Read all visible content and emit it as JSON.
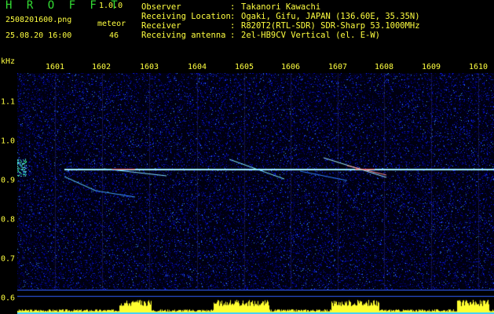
{
  "app": {
    "title": "H R O F F T",
    "version": "1.0.0"
  },
  "file_name": "2508201600.png",
  "datetime": "25.08.20 16:00",
  "meteor": {
    "label": "meteor",
    "count": "46"
  },
  "info": [
    {
      "key": "Observer",
      "value": "Takanori Kawachi"
    },
    {
      "key": "Receiving Location",
      "value": "Ogaki, Gifu, JAPAN (136.60E, 35.35N)"
    },
    {
      "key": "Receiver",
      "value": "R820T2(RTL-SDR) SDR-Sharp 53.1000MHz"
    },
    {
      "key": "Receiving antenna",
      "value": "2el-HB9CV Vertical (el. E-W)"
    }
  ],
  "separator": ":",
  "axis": {
    "y_unit": "kHz",
    "x_ticks": [
      "1601",
      "1602",
      "1603",
      "1604",
      "1605",
      "1606",
      "1607",
      "1608",
      "1609",
      "1610"
    ],
    "y_ticks": [
      "1.1",
      "1.0",
      "0.9",
      "0.8",
      "0.7",
      "0.6"
    ]
  },
  "colors": {
    "background": "#000000",
    "text": "#ffff40",
    "title": "#33dd33",
    "carrier": "#b0f0ff",
    "noise": "#0000a0"
  }
}
